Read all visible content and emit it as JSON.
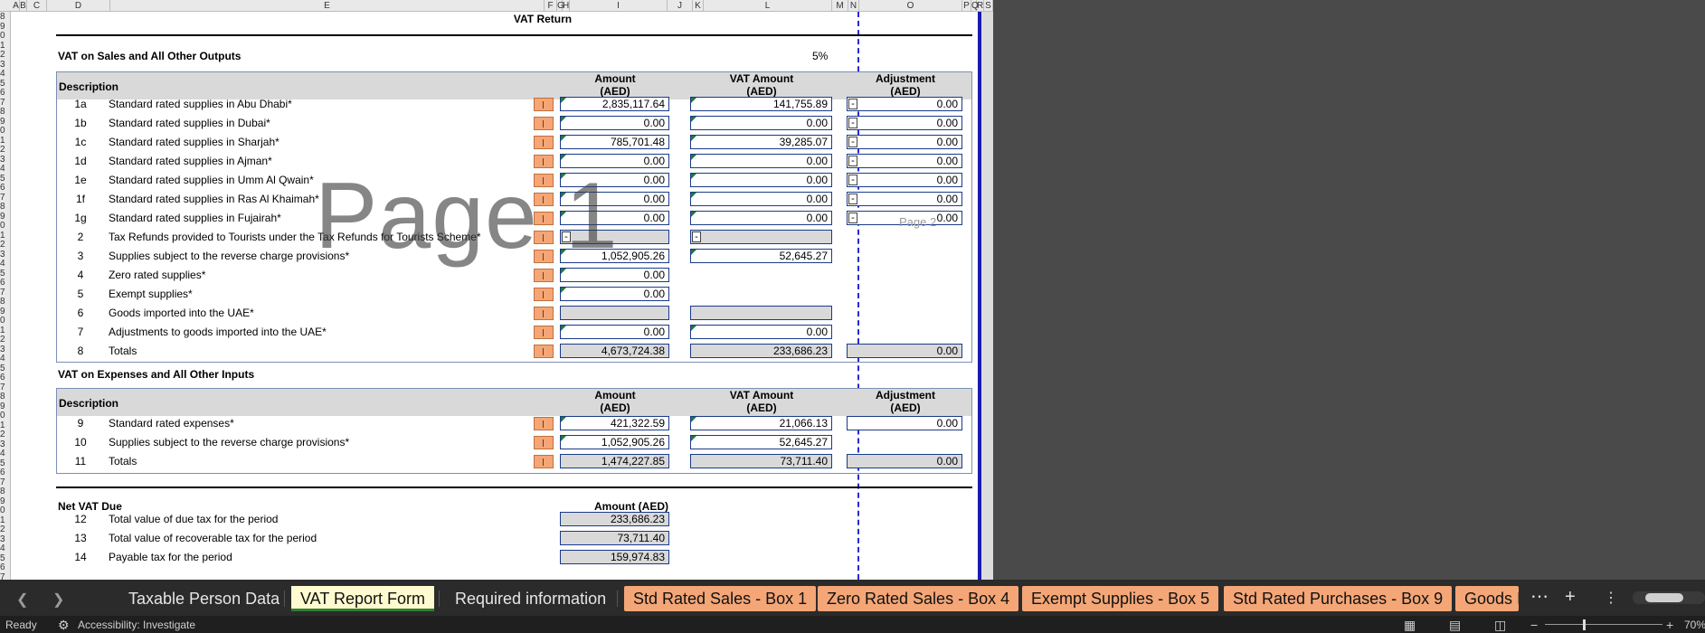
{
  "column_headers": [
    "A",
    "B",
    "C",
    "D",
    "E",
    "F",
    "G",
    "H",
    "I",
    "J",
    "K",
    "L",
    "M",
    "N",
    "O",
    "P",
    "Q",
    "R",
    "S"
  ],
  "row_numbers": [
    "8",
    "9",
    "0",
    "1",
    "2",
    "3",
    "4",
    "5",
    "6",
    "7",
    "8",
    "9",
    "0",
    "1",
    "2",
    "3",
    "4",
    "5",
    "6",
    "7",
    "8",
    "9",
    "0",
    "1",
    "2",
    "3",
    "4",
    "5",
    "6",
    "7",
    "8",
    "9",
    "0",
    "1",
    "2",
    "3",
    "4",
    "5",
    "6",
    "7",
    "8",
    "9",
    "0",
    "1",
    "2",
    "3",
    "4",
    "5",
    "6",
    "7",
    "8",
    "9",
    "0",
    "1",
    "2",
    "3",
    "4",
    "5",
    "6",
    "7"
  ],
  "sheet_title": "VAT Return",
  "outputs": {
    "section_title": "VAT on Sales and All Other Outputs",
    "percent": "5%",
    "headers": {
      "description": "Description",
      "amount": "Amount",
      "amount_unit": "(AED)",
      "vat_amount": "VAT Amount",
      "vat_unit": "(AED)",
      "adjustment": "Adjustment",
      "adjustment_unit": "(AED)"
    },
    "rows": [
      {
        "code": "1a",
        "desc": "Standard rated supplies in Abu Dhabi*",
        "amount": "2,835,117.64",
        "vat": "141,755.89",
        "adj": "0.00"
      },
      {
        "code": "1b",
        "desc": "Standard rated supplies in Dubai*",
        "amount": "0.00",
        "vat": "0.00",
        "adj": "0.00"
      },
      {
        "code": "1c",
        "desc": "Standard rated supplies in Sharjah*",
        "amount": "785,701.48",
        "vat": "39,285.07",
        "adj": "0.00"
      },
      {
        "code": "1d",
        "desc": "Standard rated supplies in Ajman*",
        "amount": "0.00",
        "vat": "0.00",
        "adj": "0.00"
      },
      {
        "code": "1e",
        "desc": "Standard rated supplies in Umm Al Qwain*",
        "amount": "0.00",
        "vat": "0.00",
        "adj": "0.00"
      },
      {
        "code": "1f",
        "desc": "Standard rated supplies in Ras Al Khaimah*",
        "amount": "0.00",
        "vat": "0.00",
        "adj": "0.00"
      },
      {
        "code": "1g",
        "desc": "Standard rated supplies in Fujairah*",
        "amount": "0.00",
        "vat": "0.00",
        "adj": "0.00"
      },
      {
        "code": "2",
        "desc": "Tax Refunds provided to Tourists under the Tax Refunds for Tourists Scheme*",
        "amount": "",
        "vat": ""
      },
      {
        "code": "3",
        "desc": "Supplies subject to the reverse charge provisions*",
        "amount": "1,052,905.26",
        "vat": "52,645.27"
      },
      {
        "code": "4",
        "desc": "Zero rated supplies*",
        "amount": "0.00"
      },
      {
        "code": "5",
        "desc": "Exempt supplies*",
        "amount": "0.00"
      },
      {
        "code": "6",
        "desc": "Goods imported into the UAE*",
        "amount": "",
        "vat": ""
      },
      {
        "code": "7",
        "desc": "Adjustments to goods imported into the UAE*",
        "amount": "0.00",
        "vat": "0.00"
      },
      {
        "code": "8",
        "desc": "Totals",
        "amount": "4,673,724.38",
        "vat": "233,686.23",
        "adj": "0.00"
      }
    ]
  },
  "inputs": {
    "section_title": "VAT on Expenses and All Other Inputs",
    "headers": {
      "description": "Description",
      "amount": "Amount",
      "amount_unit": "(AED)",
      "vat_amount": "VAT Amount",
      "vat_unit": "(AED)",
      "adjustment": "Adjustment",
      "adjustment_unit": "(AED)"
    },
    "rows": [
      {
        "code": "9",
        "desc": "Standard rated expenses*",
        "amount": "421,322.59",
        "vat": "21,066.13",
        "adj": "0.00"
      },
      {
        "code": "10",
        "desc": "Supplies subject to the reverse charge provisions*",
        "amount": "1,052,905.26",
        "vat": "52,645.27"
      },
      {
        "code": "11",
        "desc": "Totals",
        "amount": "1,474,227.85",
        "vat": "73,711.40",
        "adj": "0.00"
      }
    ]
  },
  "net": {
    "title": "Net VAT Due",
    "amount_header": "Amount (AED)",
    "rows": [
      {
        "code": "12",
        "desc": "Total value of due tax for the period",
        "amount": "233,686.23"
      },
      {
        "code": "13",
        "desc": "Total value of recoverable tax for the period",
        "amount": "73,711.40"
      },
      {
        "code": "14",
        "desc": "Payable tax for the period",
        "amount": "159,974.83"
      }
    ]
  },
  "minus_sign": "-",
  "watermark": "Page 1",
  "page2_label": "Page 2",
  "tabs": [
    {
      "label": "Taxable Person Data",
      "style": "normal"
    },
    {
      "label": "VAT Report Form",
      "style": "active"
    },
    {
      "label": "Required information",
      "style": "normal"
    },
    {
      "label": "Std Rated Sales - Box 1",
      "style": "orange"
    },
    {
      "label": "Zero Rated Sales - Box 4",
      "style": "orange"
    },
    {
      "label": "Exempt Supplies - Box 5",
      "style": "orange"
    },
    {
      "label": "Std Rated Purchases - Box 9",
      "style": "orange"
    },
    {
      "label": "Goods In",
      "style": "orange"
    }
  ],
  "status": {
    "ready": "Ready",
    "accessibility": "Accessibility: Investigate",
    "zoom": "70%"
  },
  "colors": {
    "accent_orange": "#f4a677",
    "active_tab": "#fffbd0",
    "cell_border": "#1a3a8a",
    "grey_cell": "#d9d9d9"
  }
}
